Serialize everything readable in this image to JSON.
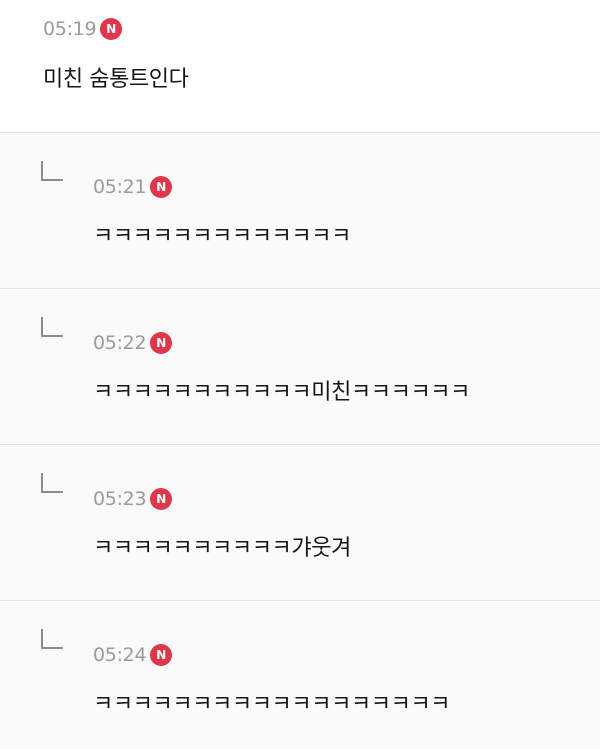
{
  "thread": {
    "comment": {
      "time": "05:19",
      "badge": "N",
      "text": "미친 숨통트인다"
    },
    "replies": [
      {
        "time": "05:21",
        "badge": "N",
        "text": "ㅋㅋㅋㅋㅋㅋㅋㅋㅋㅋㅋㅋㅋ"
      },
      {
        "time": "05:22",
        "badge": "N",
        "text": "ㅋㅋㅋㅋㅋㅋㅋㅋㅋㅋㅋ미친ㅋㅋㅋㅋㅋㅋ"
      },
      {
        "time": "05:23",
        "badge": "N",
        "text": "ㅋㅋㅋㅋㅋㅋㅋㅋㅋㅋ갸웃겨"
      },
      {
        "time": "05:24",
        "badge": "N",
        "text": "ㅋㅋㅋㅋㅋㅋㅋㅋㅋㅋㅋㅋㅋㅋㅋㅋㅋㅋ"
      }
    ]
  },
  "colors": {
    "badge": "#e0364a",
    "timestamp": "#9b9b9b",
    "text": "#161616",
    "reply_background": "#fafafa",
    "divider": "#e4e4e4"
  },
  "icons": {
    "reply": "reply-arrow-icon",
    "new": "new-badge-icon"
  }
}
